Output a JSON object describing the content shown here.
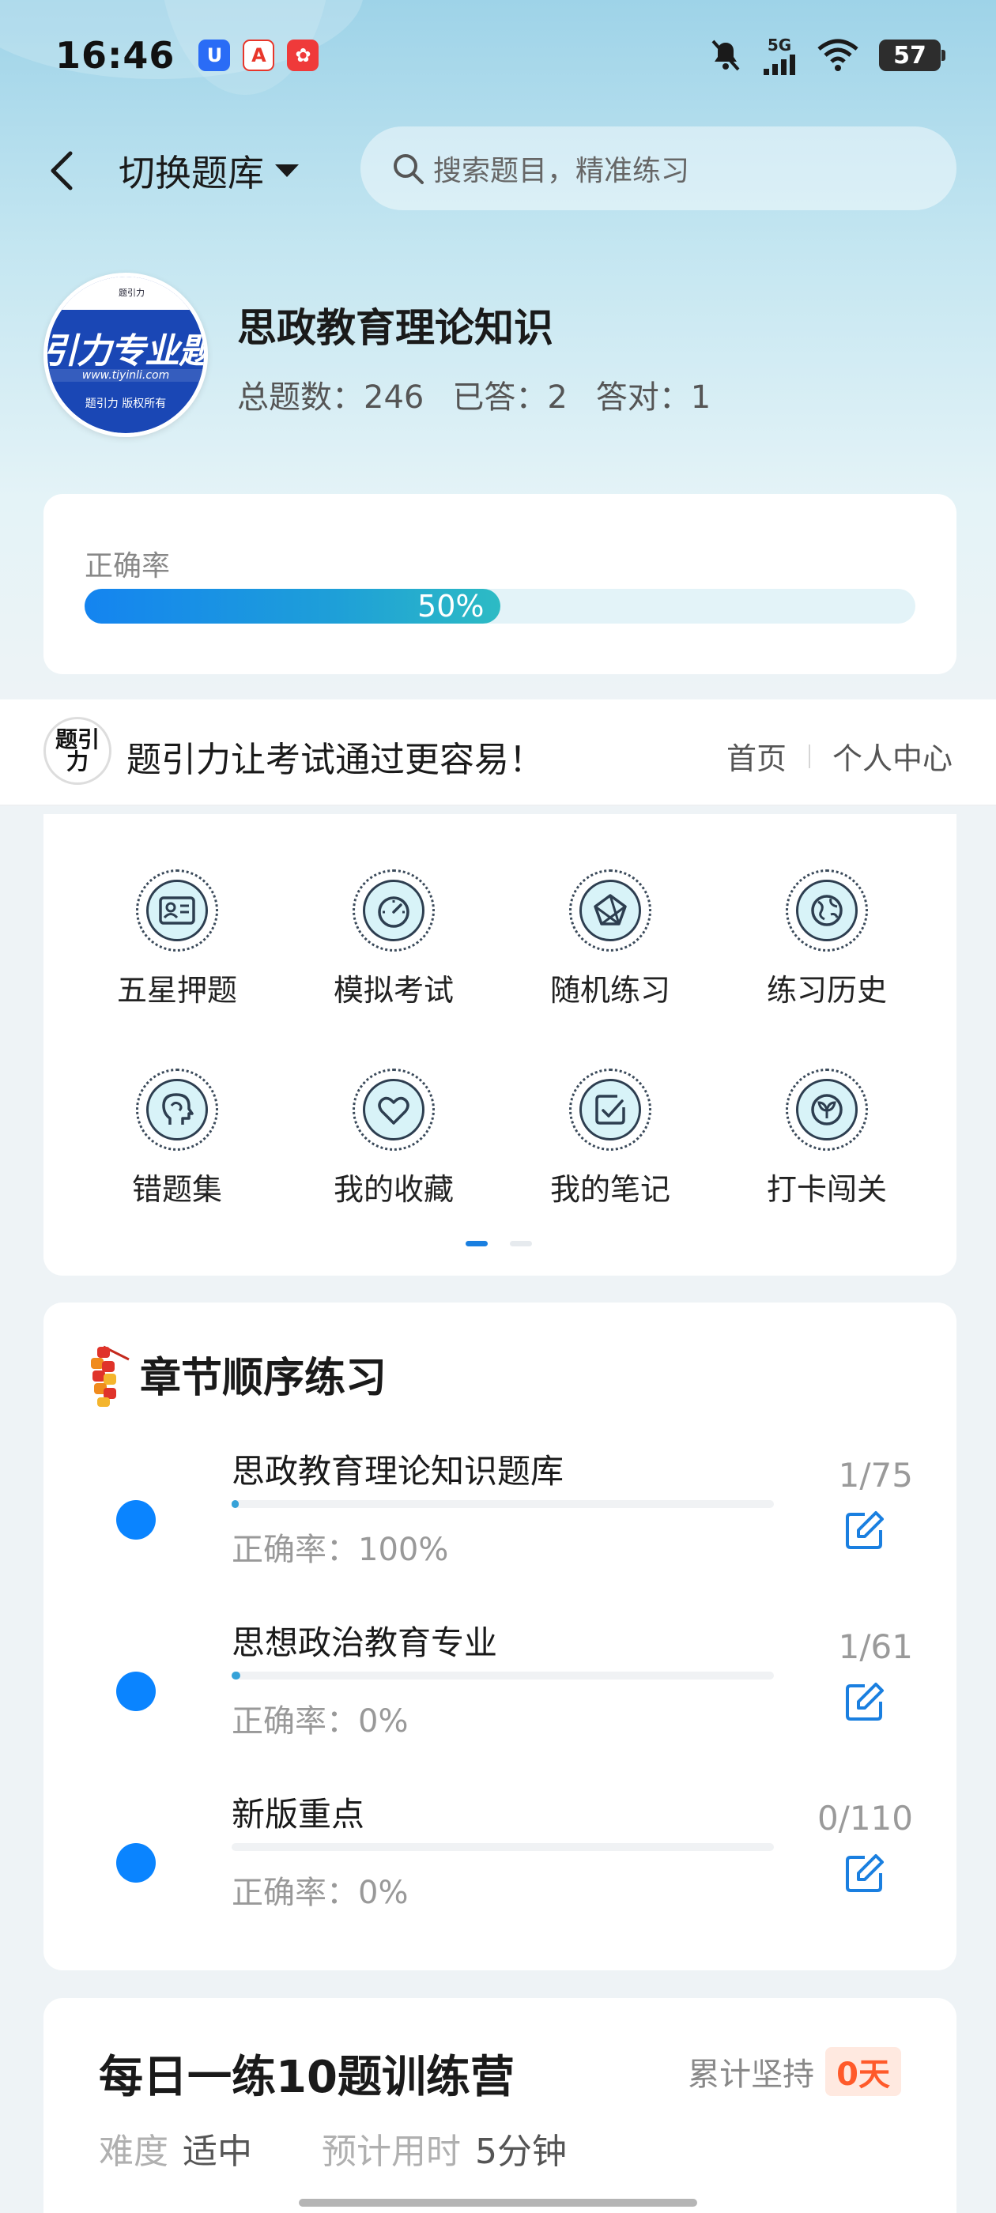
{
  "status_bar": {
    "time": "16:46",
    "network": "5G",
    "battery": "57",
    "app_icons": [
      {
        "name": "u-app-icon",
        "glyph": "U",
        "color": "#2a6cf6"
      },
      {
        "name": "a-app-icon",
        "glyph": "A",
        "color": "#e8362a"
      },
      {
        "name": "red-app-icon",
        "glyph": "✿",
        "color": "#ef3a3a"
      }
    ]
  },
  "header": {
    "switch_label": "切换题库",
    "search_placeholder": "搜索题目，精准练习"
  },
  "bank": {
    "logo_big_text": "引力专业题",
    "logo_url": "www.tiyinli.com",
    "logo_copyright": "题引力 版权所有",
    "logo_top": "题引力",
    "title": "思政教育理论知识",
    "total_label": "总题数：246",
    "answered_label": "已答：2",
    "correct_label": "答对：1"
  },
  "accuracy": {
    "label": "正确率",
    "value_text": "50%",
    "fraction": 0.5
  },
  "banner": {
    "logo_text": "题引力",
    "slogan": "题引力让考试通过更容易！",
    "home_link": "首页",
    "profile_link": "个人中心"
  },
  "features": [
    {
      "label": "五星押题",
      "icon": "id-card-icon"
    },
    {
      "label": "模拟考试",
      "icon": "speedometer-icon"
    },
    {
      "label": "随机练习",
      "icon": "network-icon"
    },
    {
      "label": "练习历史",
      "icon": "globe-icon"
    },
    {
      "label": "错题集",
      "icon": "head-icon"
    },
    {
      "label": "我的收藏",
      "icon": "heart-icon"
    },
    {
      "label": "我的笔记",
      "icon": "note-check-icon"
    },
    {
      "label": "打卡闯关",
      "icon": "leaf-badge-icon"
    }
  ],
  "chapter": {
    "title": "章节顺序练习",
    "items": [
      {
        "name": "思政教育理论知识题库",
        "accuracy": "正确率：100%",
        "count": "1/75",
        "progress": 0.0133
      },
      {
        "name": "思想政治教育专业",
        "accuracy": "正确率：0%",
        "count": "1/61",
        "progress": 0.0164
      },
      {
        "name": "新版重点",
        "accuracy": "正确率：0%",
        "count": "0/110",
        "progress": 0
      }
    ]
  },
  "daily": {
    "title": "每日一练10题训练营",
    "streak_label": "累计坚持",
    "streak_value": "0天",
    "difficulty_label": "难度",
    "difficulty_value": "适中",
    "time_label": "预计用时",
    "time_value": "5分钟"
  },
  "colors": {
    "accent": "#0a84ff",
    "streak": "#ff5a2a"
  }
}
